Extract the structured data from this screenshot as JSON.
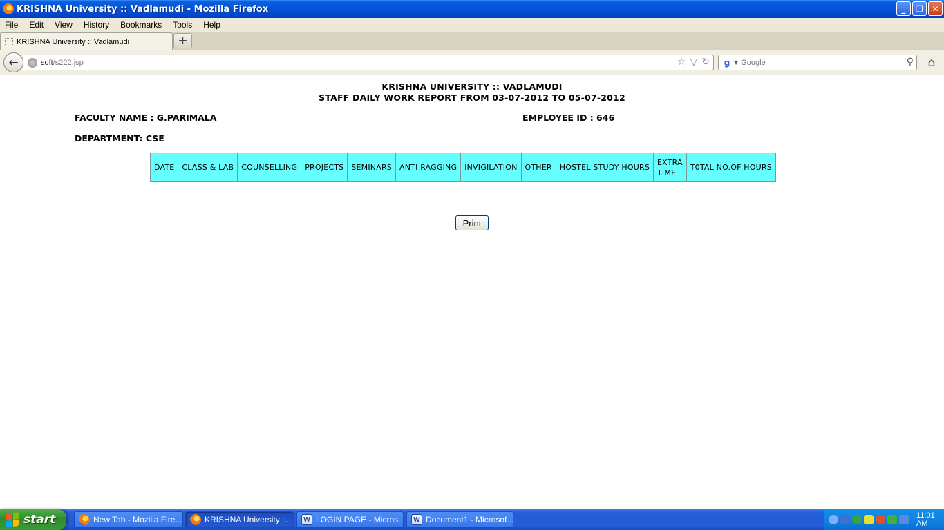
{
  "window": {
    "title": "KRISHNA University :: Vadlamudi - Mozilla Firefox",
    "min": "_",
    "restore": "❐",
    "close": "✕"
  },
  "menu": [
    "File",
    "Edit",
    "View",
    "History",
    "Bookmarks",
    "Tools",
    "Help"
  ],
  "tab": {
    "label": "KRISHNA University :: Vadlamudi",
    "new_tab": "+"
  },
  "nav": {
    "back": "←",
    "url_host": "soft",
    "url_path": "/s222.jsp",
    "star": "☆",
    "dropdown": "▽",
    "reload": "↻",
    "search_engine": "g",
    "search_placeholder": "Google",
    "search_go": "⚲",
    "home": "⌂"
  },
  "report": {
    "university": "KRISHNA UNIVERSITY :: VADLAMUDI",
    "subtitle": "STAFF DAILY WORK REPORT FROM 03-07-2012 TO 05-07-2012",
    "faculty": "FACULTY NAME : G.PARIMALA",
    "employee": "EMPLOYEE ID : 646",
    "department": "DEPARTMENT: CSE",
    "columns": [
      "DATE",
      "CLASS & LAB",
      "COUNSELLING",
      "PROJECTS",
      "SEMINARS",
      "ANTI RAGGING",
      "INVIGILATION",
      "OTHER",
      "HOSTEL STUDY HOURS",
      "EXTRA\nTIME",
      "T0TAL NO.OF HOURS"
    ],
    "print_label": "Print",
    "header_color": "#66ffff"
  },
  "taskbar": {
    "start": "start",
    "tasks": [
      {
        "label": "New Tab - Mozilla Fire...",
        "icon": "firefox-icon",
        "active": false
      },
      {
        "label": "KRISHNA University :...",
        "icon": "firefox-icon",
        "active": true
      },
      {
        "label": "LOGIN PAGE - Micros...",
        "icon": "word-icon",
        "active": false
      },
      {
        "label": "Document1 - Microsof...",
        "icon": "word-icon",
        "active": false
      }
    ],
    "clock": "11:01 AM"
  }
}
